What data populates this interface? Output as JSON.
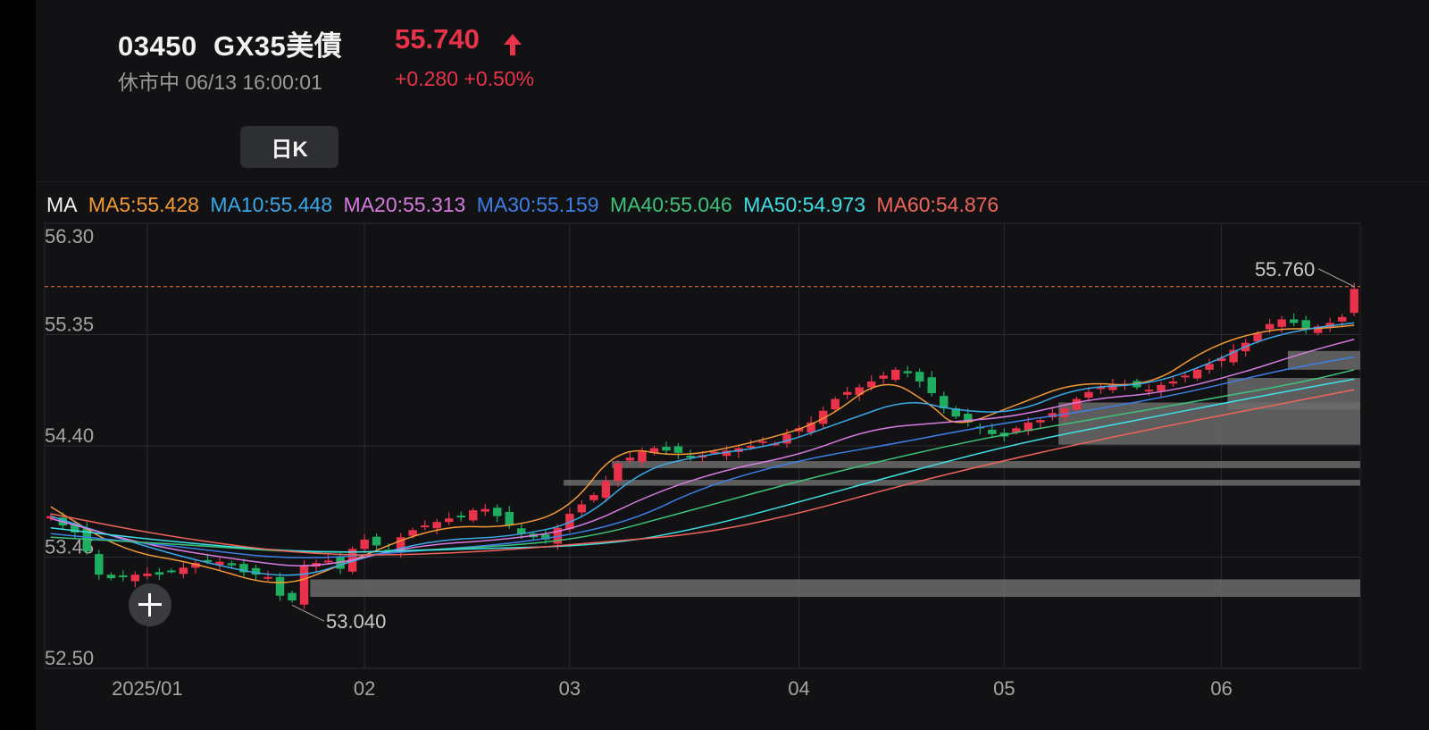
{
  "header": {
    "code": "03450",
    "name": "GX35美債",
    "price": "55.740",
    "status": "休市中",
    "datetime": "06/13 16:00:01",
    "change": "+0.280",
    "change_pct": "+0.50%",
    "up_color": "#e8334a"
  },
  "period": {
    "label": "日K"
  },
  "ma_legend": {
    "label": "MA",
    "items": [
      {
        "text": "MA5:55.428",
        "color": "#f39a37"
      },
      {
        "text": "MA10:55.448",
        "color": "#3aa8e8"
      },
      {
        "text": "MA20:55.313",
        "color": "#d77ce0"
      },
      {
        "text": "MA30:55.159",
        "color": "#3d7fe6"
      },
      {
        "text": "MA40:55.046",
        "color": "#3ec27a"
      },
      {
        "text": "MA50:54.973",
        "color": "#3fe0e6"
      },
      {
        "text": "MA60:54.876",
        "color": "#f0655b"
      }
    ]
  },
  "chart_data": {
    "type": "candlestick",
    "y_ticks": [
      "56.30",
      "55.35",
      "54.40",
      "53.45",
      "52.50"
    ],
    "ylim": [
      52.5,
      56.3
    ],
    "x_ticks": [
      "2025/01",
      "02",
      "03",
      "04",
      "05",
      "06"
    ],
    "x_tick_days": [
      8,
      26,
      43,
      62,
      79,
      97
    ],
    "n_days": 109,
    "high_label": "55.760",
    "low_label": "53.040",
    "last_price_line": 55.76,
    "up_color": "#e8334a",
    "down_color": "#1fae5f",
    "close_series": [
      53.8,
      53.72,
      53.66,
      53.5,
      53.3,
      53.27,
      53.28,
      53.3,
      53.31,
      53.3,
      53.33,
      53.36,
      53.4,
      53.42,
      53.41,
      53.38,
      53.32,
      53.3,
      53.28,
      53.12,
      53.08,
      53.38,
      53.4,
      53.42,
      53.35,
      53.52,
      53.6,
      53.55,
      53.5,
      53.62,
      53.68,
      53.72,
      53.75,
      53.78,
      53.8,
      53.85,
      53.86,
      53.8,
      53.72,
      53.65,
      53.62,
      53.6,
      53.7,
      53.82,
      53.9,
      53.98,
      54.1,
      54.25,
      54.3,
      54.35,
      54.38,
      54.36,
      54.34,
      54.3,
      54.32,
      54.35,
      54.36,
      54.38,
      54.4,
      54.44,
      54.42,
      54.5,
      54.55,
      54.6,
      54.7,
      54.8,
      54.86,
      54.9,
      54.95,
      55.0,
      55.05,
      55.02,
      54.95,
      54.85,
      54.72,
      54.65,
      54.6,
      54.55,
      54.5,
      54.48,
      54.55,
      54.6,
      54.62,
      54.68,
      54.72,
      54.8,
      54.86,
      54.9,
      54.92,
      54.93,
      54.9,
      54.88,
      54.92,
      54.95,
      55.0,
      55.05,
      55.1,
      55.15,
      55.22,
      55.28,
      55.36,
      55.44,
      55.48,
      55.45,
      55.4,
      55.42,
      55.45,
      55.5,
      55.74
    ],
    "ma_series": [
      {
        "name": "MA5",
        "color": "#f39a37",
        "anchors": [
          [
            0,
            53.88
          ],
          [
            6,
            53.5
          ],
          [
            12,
            53.4
          ],
          [
            19,
            53.18
          ],
          [
            24,
            53.38
          ],
          [
            32,
            53.72
          ],
          [
            38,
            53.7
          ],
          [
            43,
            53.85
          ],
          [
            47,
            54.4
          ],
          [
            52,
            54.3
          ],
          [
            58,
            54.42
          ],
          [
            64,
            54.6
          ],
          [
            69,
            55.0
          ],
          [
            73,
            54.75
          ],
          [
            75,
            54.55
          ],
          [
            80,
            54.75
          ],
          [
            85,
            54.95
          ],
          [
            91,
            54.9
          ],
          [
            96,
            55.25
          ],
          [
            101,
            55.4
          ],
          [
            105,
            55.4
          ],
          [
            108,
            55.43
          ]
        ]
      },
      {
        "name": "MA10",
        "color": "#3aa8e8",
        "anchors": [
          [
            0,
            53.8
          ],
          [
            6,
            53.6
          ],
          [
            12,
            53.42
          ],
          [
            20,
            53.25
          ],
          [
            26,
            53.45
          ],
          [
            32,
            53.6
          ],
          [
            38,
            53.62
          ],
          [
            44,
            53.75
          ],
          [
            49,
            54.2
          ],
          [
            54,
            54.32
          ],
          [
            60,
            54.4
          ],
          [
            66,
            54.62
          ],
          [
            71,
            54.8
          ],
          [
            75,
            54.7
          ],
          [
            80,
            54.68
          ],
          [
            85,
            54.9
          ],
          [
            91,
            54.92
          ],
          [
            96,
            55.1
          ],
          [
            100,
            55.3
          ],
          [
            104,
            55.4
          ],
          [
            108,
            55.45
          ]
        ]
      },
      {
        "name": "MA20",
        "color": "#d77ce0",
        "anchors": [
          [
            0,
            53.78
          ],
          [
            8,
            53.55
          ],
          [
            16,
            53.42
          ],
          [
            22,
            53.35
          ],
          [
            30,
            53.55
          ],
          [
            38,
            53.6
          ],
          [
            44,
            53.7
          ],
          [
            50,
            54.0
          ],
          [
            56,
            54.2
          ],
          [
            62,
            54.32
          ],
          [
            68,
            54.55
          ],
          [
            74,
            54.6
          ],
          [
            80,
            54.65
          ],
          [
            86,
            54.8
          ],
          [
            92,
            54.85
          ],
          [
            98,
            55.0
          ],
          [
            104,
            55.2
          ],
          [
            108,
            55.31
          ]
        ]
      },
      {
        "name": "MA30",
        "color": "#3d7fe6",
        "anchors": [
          [
            0,
            53.65
          ],
          [
            10,
            53.55
          ],
          [
            20,
            53.42
          ],
          [
            30,
            53.5
          ],
          [
            40,
            53.58
          ],
          [
            48,
            53.75
          ],
          [
            54,
            54.05
          ],
          [
            62,
            54.28
          ],
          [
            70,
            54.42
          ],
          [
            78,
            54.58
          ],
          [
            86,
            54.7
          ],
          [
            94,
            54.85
          ],
          [
            102,
            55.05
          ],
          [
            108,
            55.16
          ]
        ]
      },
      {
        "name": "MA40",
        "color": "#3ec27a",
        "anchors": [
          [
            0,
            53.62
          ],
          [
            12,
            53.55
          ],
          [
            22,
            53.48
          ],
          [
            34,
            53.52
          ],
          [
            44,
            53.6
          ],
          [
            52,
            53.82
          ],
          [
            62,
            54.1
          ],
          [
            70,
            54.3
          ],
          [
            78,
            54.48
          ],
          [
            86,
            54.62
          ],
          [
            96,
            54.8
          ],
          [
            104,
            54.95
          ],
          [
            108,
            55.05
          ]
        ]
      },
      {
        "name": "MA50",
        "color": "#3fe0e6",
        "anchors": [
          [
            0,
            53.7
          ],
          [
            10,
            53.58
          ],
          [
            22,
            53.48
          ],
          [
            34,
            53.52
          ],
          [
            46,
            53.55
          ],
          [
            54,
            53.7
          ],
          [
            62,
            53.92
          ],
          [
            70,
            54.15
          ],
          [
            80,
            54.42
          ],
          [
            90,
            54.62
          ],
          [
            100,
            54.82
          ],
          [
            108,
            54.97
          ]
        ]
      },
      {
        "name": "MA60",
        "color": "#f0655b",
        "anchors": [
          [
            0,
            53.82
          ],
          [
            10,
            53.62
          ],
          [
            22,
            53.46
          ],
          [
            34,
            53.48
          ],
          [
            46,
            53.58
          ],
          [
            54,
            53.65
          ],
          [
            62,
            53.82
          ],
          [
            70,
            54.05
          ],
          [
            80,
            54.3
          ],
          [
            90,
            54.52
          ],
          [
            100,
            54.72
          ],
          [
            108,
            54.88
          ]
        ]
      }
    ],
    "volume_profile": [
      {
        "from_day": 47,
        "low": 54.21,
        "high": 54.27
      },
      {
        "from_day": 43,
        "low": 54.06,
        "high": 54.11
      },
      {
        "from_day": 22,
        "low": 53.11,
        "high": 53.26
      },
      {
        "from_day": 84,
        "low": 54.41,
        "high": 54.77
      },
      {
        "from_day": 98,
        "low": 54.71,
        "high": 54.98
      },
      {
        "from_day": 103,
        "low": 55.05,
        "high": 55.21
      }
    ]
  }
}
